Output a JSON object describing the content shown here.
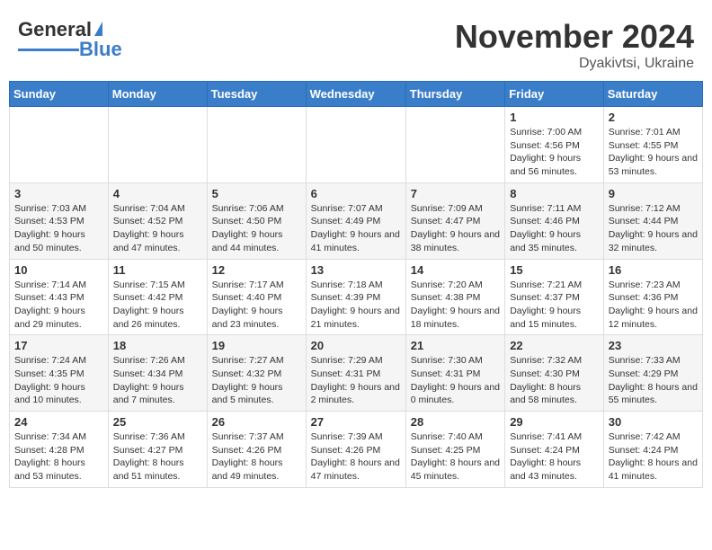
{
  "header": {
    "logo_general": "General",
    "logo_blue": "Blue",
    "month": "November 2024",
    "location": "Dyakivtsi, Ukraine"
  },
  "weekdays": [
    "Sunday",
    "Monday",
    "Tuesday",
    "Wednesday",
    "Thursday",
    "Friday",
    "Saturday"
  ],
  "weeks": [
    [
      {
        "day": "",
        "info": ""
      },
      {
        "day": "",
        "info": ""
      },
      {
        "day": "",
        "info": ""
      },
      {
        "day": "",
        "info": ""
      },
      {
        "day": "",
        "info": ""
      },
      {
        "day": "1",
        "info": "Sunrise: 7:00 AM\nSunset: 4:56 PM\nDaylight: 9 hours and 56 minutes."
      },
      {
        "day": "2",
        "info": "Sunrise: 7:01 AM\nSunset: 4:55 PM\nDaylight: 9 hours and 53 minutes."
      }
    ],
    [
      {
        "day": "3",
        "info": "Sunrise: 7:03 AM\nSunset: 4:53 PM\nDaylight: 9 hours and 50 minutes."
      },
      {
        "day": "4",
        "info": "Sunrise: 7:04 AM\nSunset: 4:52 PM\nDaylight: 9 hours and 47 minutes."
      },
      {
        "day": "5",
        "info": "Sunrise: 7:06 AM\nSunset: 4:50 PM\nDaylight: 9 hours and 44 minutes."
      },
      {
        "day": "6",
        "info": "Sunrise: 7:07 AM\nSunset: 4:49 PM\nDaylight: 9 hours and 41 minutes."
      },
      {
        "day": "7",
        "info": "Sunrise: 7:09 AM\nSunset: 4:47 PM\nDaylight: 9 hours and 38 minutes."
      },
      {
        "day": "8",
        "info": "Sunrise: 7:11 AM\nSunset: 4:46 PM\nDaylight: 9 hours and 35 minutes."
      },
      {
        "day": "9",
        "info": "Sunrise: 7:12 AM\nSunset: 4:44 PM\nDaylight: 9 hours and 32 minutes."
      }
    ],
    [
      {
        "day": "10",
        "info": "Sunrise: 7:14 AM\nSunset: 4:43 PM\nDaylight: 9 hours and 29 minutes."
      },
      {
        "day": "11",
        "info": "Sunrise: 7:15 AM\nSunset: 4:42 PM\nDaylight: 9 hours and 26 minutes."
      },
      {
        "day": "12",
        "info": "Sunrise: 7:17 AM\nSunset: 4:40 PM\nDaylight: 9 hours and 23 minutes."
      },
      {
        "day": "13",
        "info": "Sunrise: 7:18 AM\nSunset: 4:39 PM\nDaylight: 9 hours and 21 minutes."
      },
      {
        "day": "14",
        "info": "Sunrise: 7:20 AM\nSunset: 4:38 PM\nDaylight: 9 hours and 18 minutes."
      },
      {
        "day": "15",
        "info": "Sunrise: 7:21 AM\nSunset: 4:37 PM\nDaylight: 9 hours and 15 minutes."
      },
      {
        "day": "16",
        "info": "Sunrise: 7:23 AM\nSunset: 4:36 PM\nDaylight: 9 hours and 12 minutes."
      }
    ],
    [
      {
        "day": "17",
        "info": "Sunrise: 7:24 AM\nSunset: 4:35 PM\nDaylight: 9 hours and 10 minutes."
      },
      {
        "day": "18",
        "info": "Sunrise: 7:26 AM\nSunset: 4:34 PM\nDaylight: 9 hours and 7 minutes."
      },
      {
        "day": "19",
        "info": "Sunrise: 7:27 AM\nSunset: 4:32 PM\nDaylight: 9 hours and 5 minutes."
      },
      {
        "day": "20",
        "info": "Sunrise: 7:29 AM\nSunset: 4:31 PM\nDaylight: 9 hours and 2 minutes."
      },
      {
        "day": "21",
        "info": "Sunrise: 7:30 AM\nSunset: 4:31 PM\nDaylight: 9 hours and 0 minutes."
      },
      {
        "day": "22",
        "info": "Sunrise: 7:32 AM\nSunset: 4:30 PM\nDaylight: 8 hours and 58 minutes."
      },
      {
        "day": "23",
        "info": "Sunrise: 7:33 AM\nSunset: 4:29 PM\nDaylight: 8 hours and 55 minutes."
      }
    ],
    [
      {
        "day": "24",
        "info": "Sunrise: 7:34 AM\nSunset: 4:28 PM\nDaylight: 8 hours and 53 minutes."
      },
      {
        "day": "25",
        "info": "Sunrise: 7:36 AM\nSunset: 4:27 PM\nDaylight: 8 hours and 51 minutes."
      },
      {
        "day": "26",
        "info": "Sunrise: 7:37 AM\nSunset: 4:26 PM\nDaylight: 8 hours and 49 minutes."
      },
      {
        "day": "27",
        "info": "Sunrise: 7:39 AM\nSunset: 4:26 PM\nDaylight: 8 hours and 47 minutes."
      },
      {
        "day": "28",
        "info": "Sunrise: 7:40 AM\nSunset: 4:25 PM\nDaylight: 8 hours and 45 minutes."
      },
      {
        "day": "29",
        "info": "Sunrise: 7:41 AM\nSunset: 4:24 PM\nDaylight: 8 hours and 43 minutes."
      },
      {
        "day": "30",
        "info": "Sunrise: 7:42 AM\nSunset: 4:24 PM\nDaylight: 8 hours and 41 minutes."
      }
    ]
  ]
}
